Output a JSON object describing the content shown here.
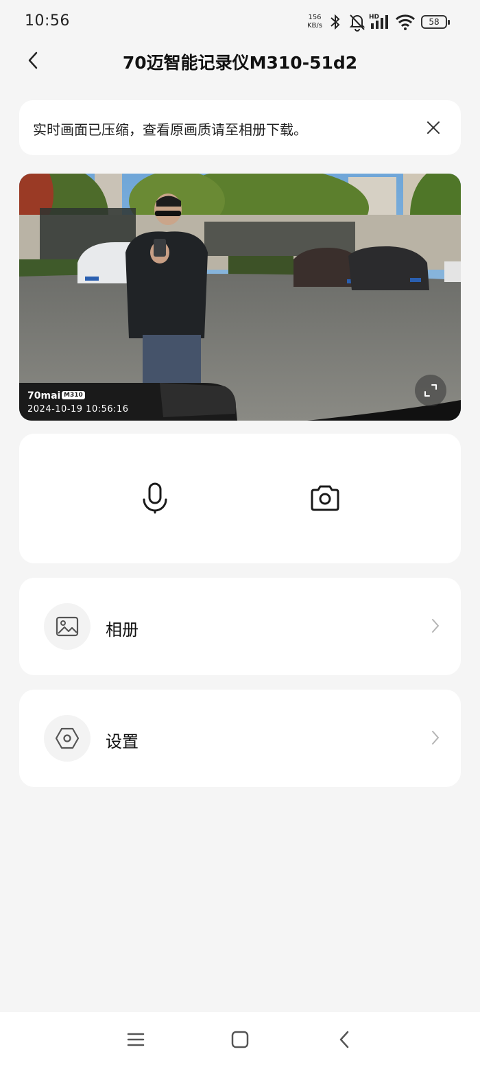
{
  "status_bar": {
    "time": "10:56",
    "net_speed_value": "156",
    "net_speed_unit": "KB/s",
    "signal_label": "HD",
    "battery": "58",
    "icons": [
      "bluetooth-icon",
      "bell-off-icon",
      "signal-icon",
      "wifi-icon",
      "battery-icon"
    ]
  },
  "header": {
    "title": "70迈智能记录仪M310-51d2",
    "back_icon": "chevron-left-icon"
  },
  "notice": {
    "text": "实时画面已压缩，查看原画质请至相册下载。",
    "close_icon": "close-icon"
  },
  "video": {
    "watermark_brand": "70mai",
    "watermark_model": "M310",
    "timestamp": "2024-10-19  10:56:16",
    "fullscreen_icon": "fullscreen-icon"
  },
  "controls": {
    "mic_icon": "microphone-icon",
    "camera_icon": "camera-icon"
  },
  "menu": [
    {
      "label": "相册",
      "icon": "image-icon"
    },
    {
      "label": "设置",
      "icon": "settings-hexagon-icon"
    }
  ],
  "nav_bar": {
    "icons": [
      "menu-icon",
      "home-square-icon",
      "back-triangle-icon"
    ]
  }
}
